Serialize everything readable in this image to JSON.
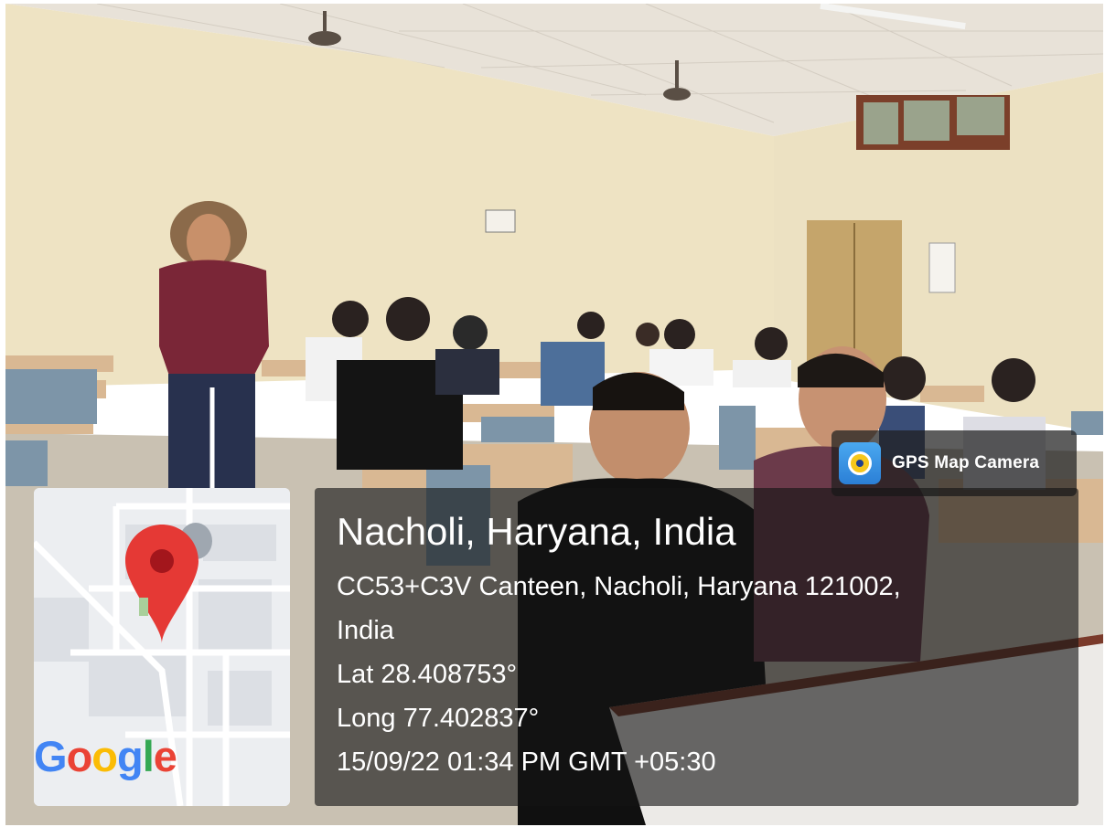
{
  "badge": {
    "app_name": "GPS Map Camera",
    "logo_icon": "gps-map-camera-icon"
  },
  "map": {
    "pin_icon": "location-pin-icon",
    "pin_color": "#e53935",
    "provider_logo": "Google"
  },
  "location": {
    "title": "Nacholi, Haryana, India",
    "address_line1": "CC53+C3V Canteen, Nacholi, Haryana 121002,",
    "address_line2": "India",
    "latitude": "Lat 28.408753°",
    "longitude": "Long 77.402837°",
    "datetime": "15/09/22 01:34 PM GMT +05:30"
  },
  "colors": {
    "panel_bg": "rgba(20,20,20,0.62)",
    "google_blue": "#4285F4",
    "google_red": "#EA4335",
    "google_yellow": "#FBBC05",
    "google_green": "#34A853"
  }
}
